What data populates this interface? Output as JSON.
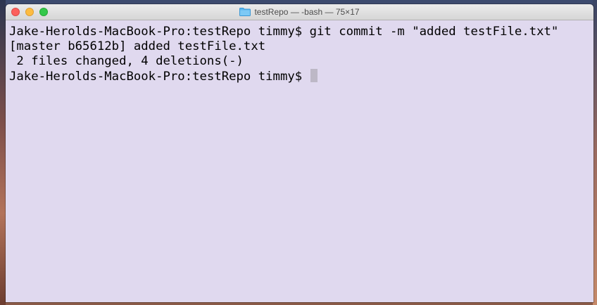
{
  "window": {
    "title": "testRepo — -bash — 75×17",
    "folder_icon": "folder-icon",
    "controls": [
      "close",
      "minimize",
      "zoom"
    ]
  },
  "colors": {
    "terminal_background": "#e0d9ef",
    "close": "#fc605c",
    "minimize": "#fdbc40",
    "zoom": "#34c84a",
    "folder": "#5bb8f0"
  },
  "terminal": {
    "lines": [
      "Jake-Herolds-MacBook-Pro:testRepo timmy$ git commit -m \"added testFile.txt\"",
      "[master b65612b] added testFile.txt",
      " 2 files changed, 4 deletions(-)",
      "Jake-Herolds-MacBook-Pro:testRepo timmy$ "
    ]
  }
}
